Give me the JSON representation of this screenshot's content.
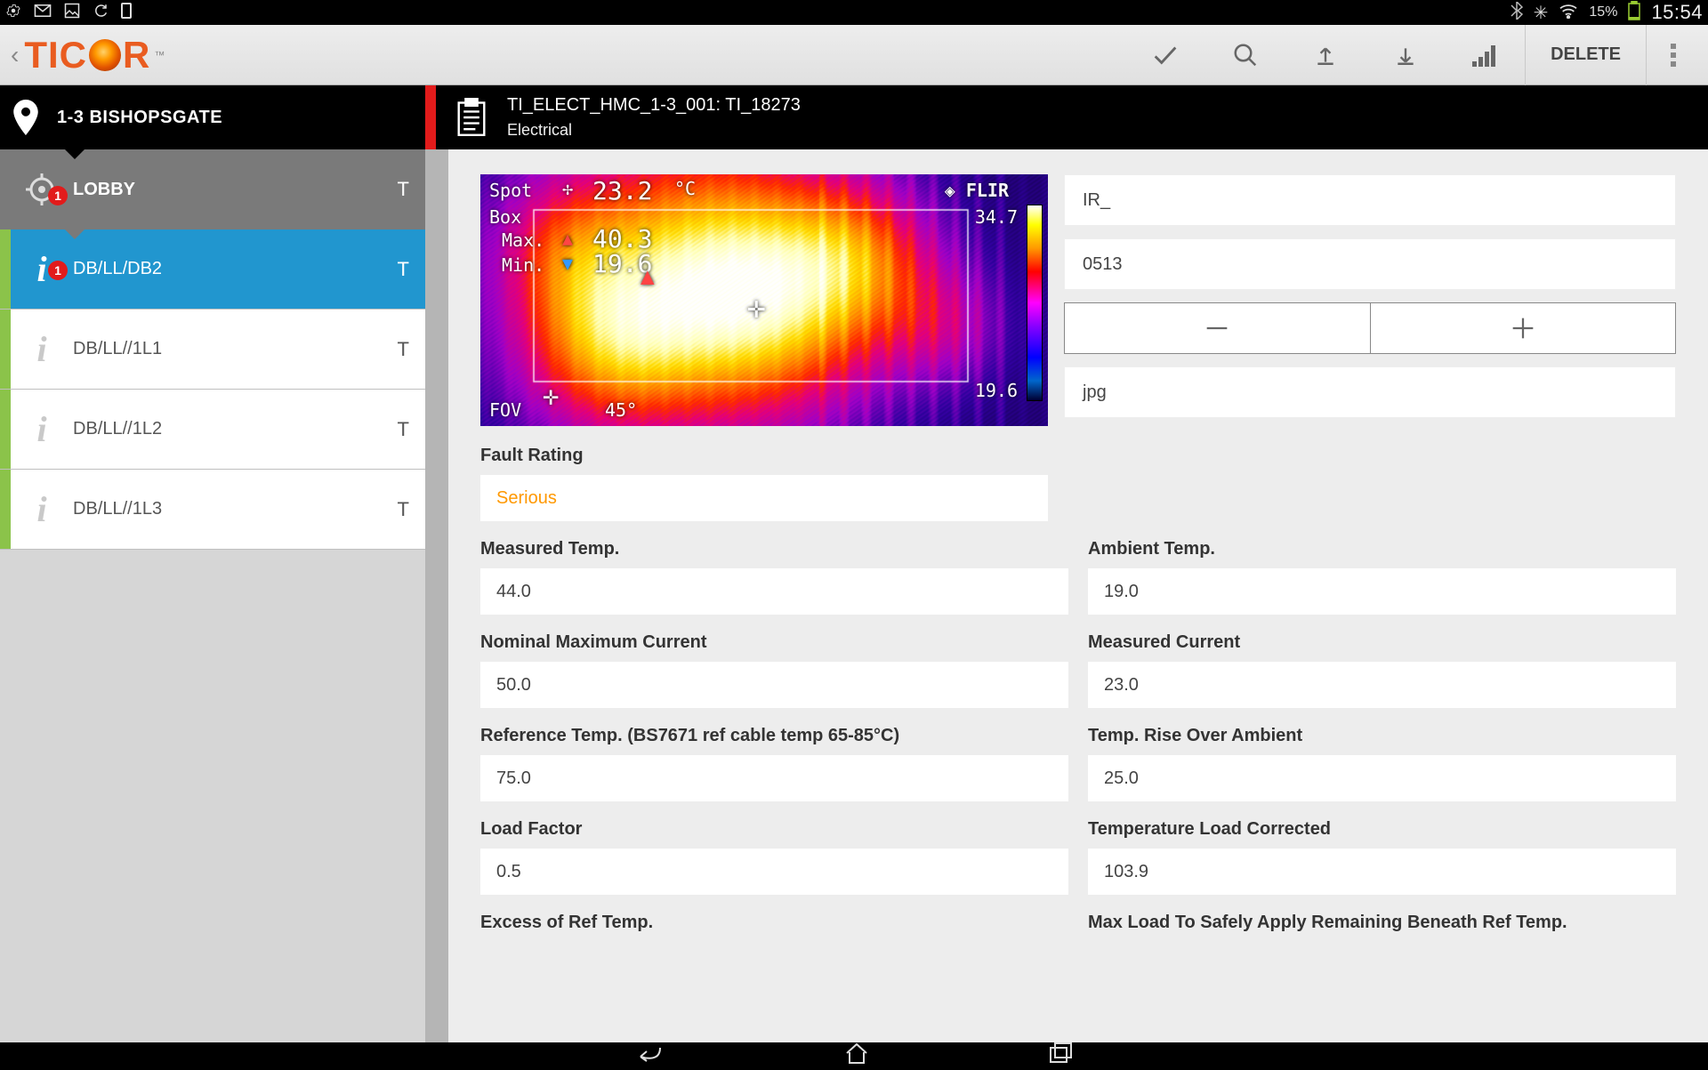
{
  "status_bar": {
    "battery_text": "15%",
    "time": "15:54"
  },
  "app_header": {
    "logo_text_left": "TIC",
    "logo_text_right": "R",
    "delete_label": "DELETE"
  },
  "black_bar": {
    "location_name": "1-3 BISHOPSGATE",
    "doc_title": "TI_ELECT_HMC_1-3_001: TI_18273",
    "doc_subtitle": "Electrical"
  },
  "sidebar": {
    "items": [
      {
        "label": "LOBBY",
        "badge": "1",
        "t": "T",
        "kind": "header"
      },
      {
        "label": "DB/LL/DB2",
        "badge": "1",
        "t": "T",
        "kind": "selected"
      },
      {
        "label": "DB/LL//1L1",
        "badge": "",
        "t": "T",
        "kind": "normal"
      },
      {
        "label": "DB/LL//1L2",
        "badge": "",
        "t": "T",
        "kind": "normal"
      },
      {
        "label": "DB/LL//1L3",
        "badge": "",
        "t": "T",
        "kind": "normal"
      }
    ]
  },
  "thermal_overlay": {
    "spot_label": "Spot",
    "spot_value": "23.2",
    "unit": "°C",
    "box_label": "Box",
    "max_label": "Max.",
    "max_value": "40.3",
    "min_label": "Min.",
    "min_value": "19.6",
    "fov_label": "FOV",
    "fov_value": "45°",
    "brand": "FLIR",
    "scale_high": "34.7",
    "scale_low": "19.6"
  },
  "image_fields": {
    "prefix": "IR_",
    "number": "0513",
    "ext": "jpg"
  },
  "form": {
    "fault_rating_label": "Fault Rating",
    "fault_rating_value": "Serious",
    "rows": [
      {
        "l_label": "Measured Temp.",
        "l_value": "44.0",
        "r_label": "Ambient Temp.",
        "r_value": "19.0"
      },
      {
        "l_label": "Nominal Maximum Current",
        "l_value": "50.0",
        "r_label": "Measured Current",
        "r_value": "23.0"
      },
      {
        "l_label": "Reference Temp. (BS7671 ref cable temp 65-85°C)",
        "l_value": "75.0",
        "r_label": "Temp. Rise Over Ambient",
        "r_value": "25.0"
      },
      {
        "l_label": "Load Factor",
        "l_value": "0.5",
        "r_label": "Temperature Load Corrected",
        "r_value": "103.9"
      },
      {
        "l_label": "Excess of Ref Temp.",
        "l_value": "",
        "r_label": "Max Load To Safely Apply Remaining Beneath Ref Temp.",
        "r_value": ""
      }
    ]
  }
}
